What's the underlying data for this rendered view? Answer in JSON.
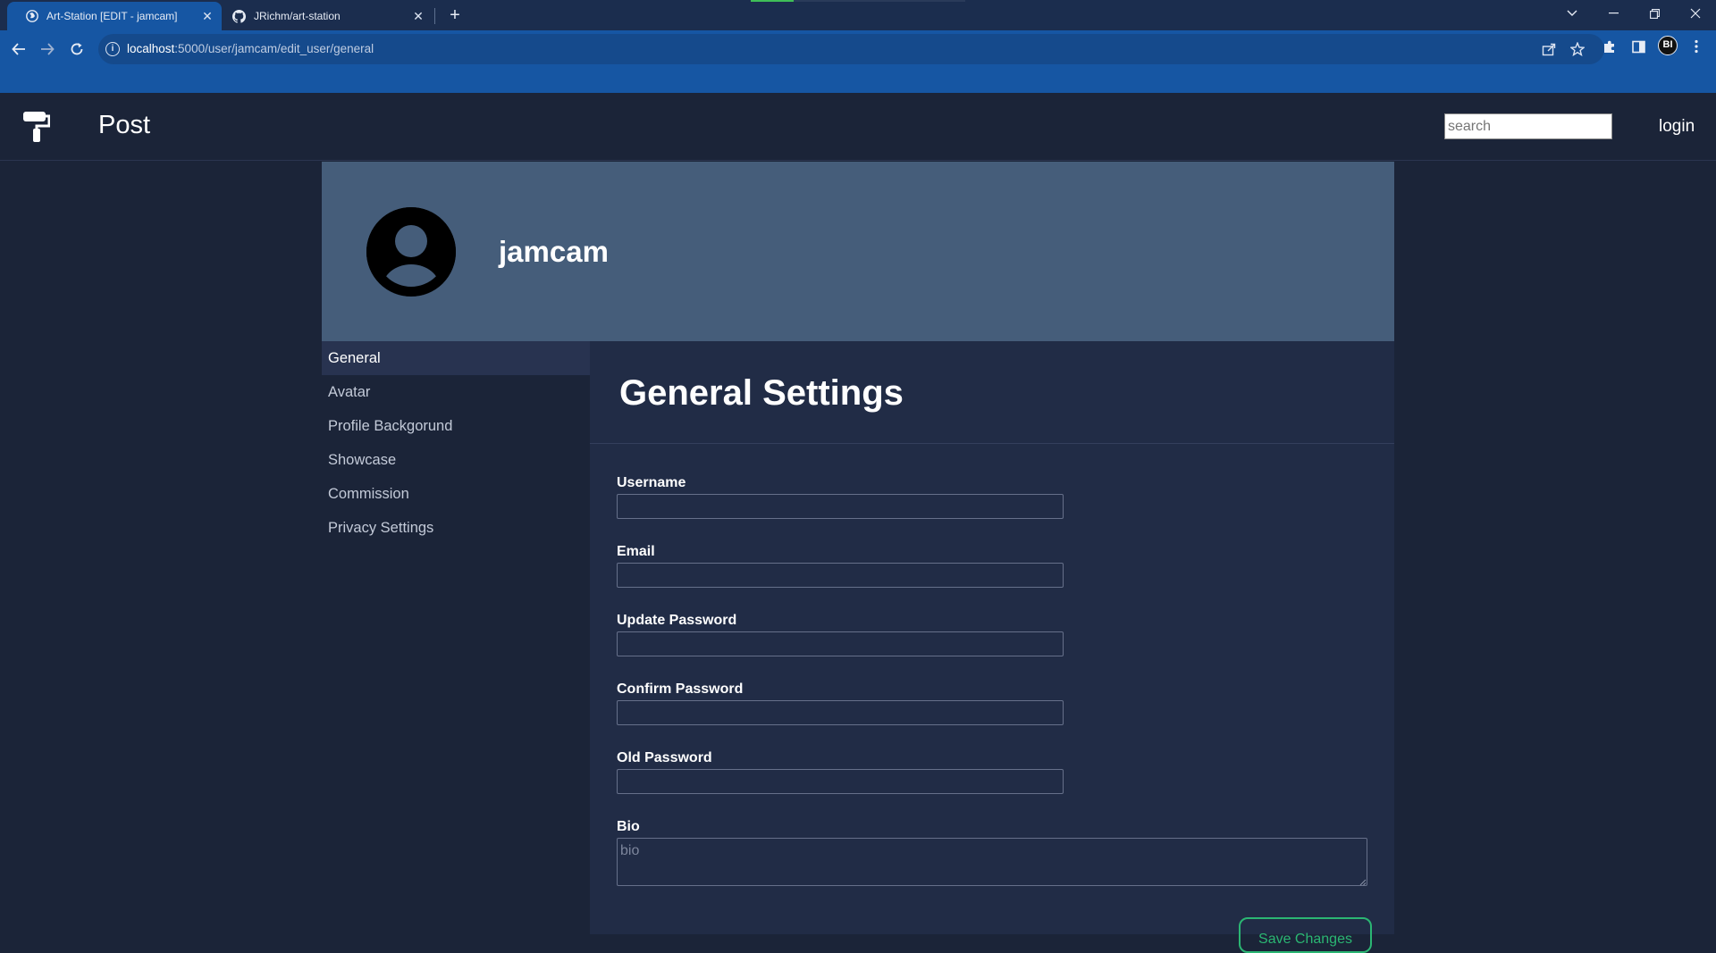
{
  "browser": {
    "tabs": [
      {
        "title": "Art-Station [EDIT - jamcam]",
        "active": true,
        "favicon": "globe-icon"
      },
      {
        "title": "JRichm/art-station",
        "active": false,
        "favicon": "github-icon"
      }
    ],
    "address": {
      "host": "localhost",
      "path": ":5000/user/jamcam/edit_user/general"
    },
    "profile_initials": "BI",
    "colors": {
      "tabbar": "#1b2d4e",
      "toolbar": "#1656a3"
    }
  },
  "site": {
    "brand": "Post",
    "logo_icon": "paint-roller-icon",
    "search_placeholder": "search",
    "login_label": "login"
  },
  "profile": {
    "username": "jamcam",
    "avatar_icon": "user-avatar-icon",
    "banner_color": "#455d7a"
  },
  "sidebar": {
    "items": [
      {
        "label": "General",
        "active": true
      },
      {
        "label": "Avatar",
        "active": false
      },
      {
        "label": "Profile Backgorund",
        "active": false
      },
      {
        "label": "Showcase",
        "active": false
      },
      {
        "label": "Commission",
        "active": false
      },
      {
        "label": "Privacy Settings",
        "active": false
      }
    ]
  },
  "settings": {
    "title": "General Settings",
    "fields": {
      "username": {
        "label": "Username",
        "value": ""
      },
      "email": {
        "label": "Email",
        "value": ""
      },
      "update_password": {
        "label": "Update Password",
        "value": ""
      },
      "confirm_password": {
        "label": "Confirm Password",
        "value": ""
      },
      "old_password": {
        "label": "Old Password",
        "value": ""
      },
      "bio": {
        "label": "Bio",
        "placeholder": "bio",
        "value": ""
      }
    },
    "save_label": "Save Changes",
    "accent_color": "#2bb673"
  }
}
